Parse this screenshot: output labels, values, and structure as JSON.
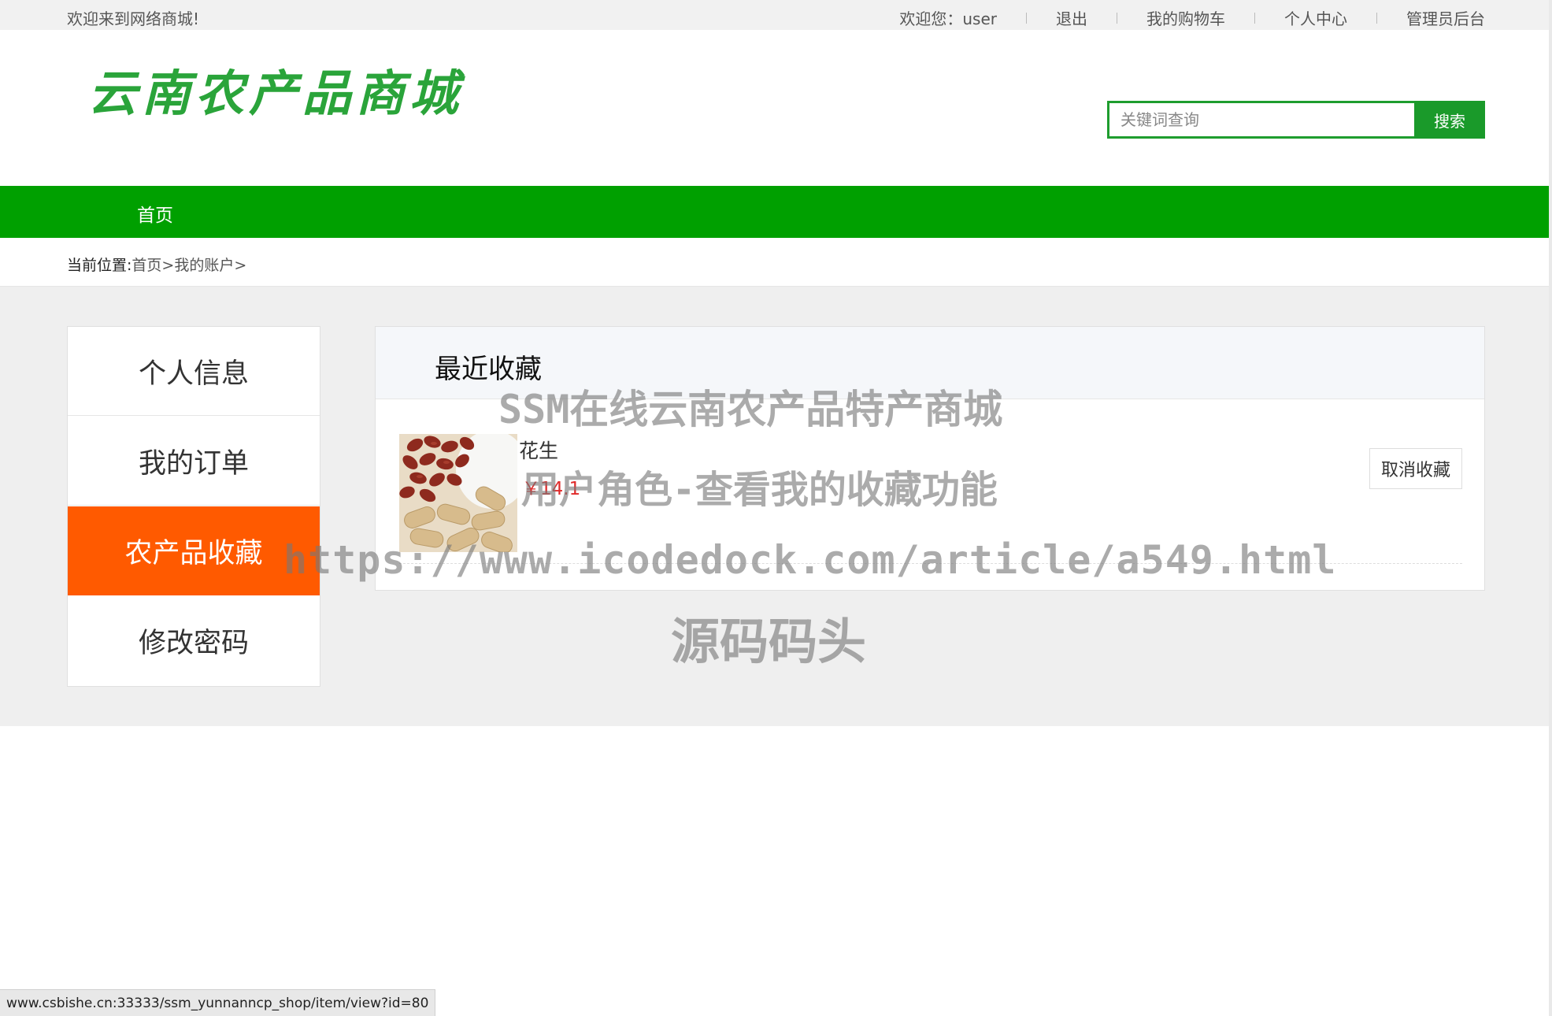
{
  "topbar": {
    "welcome": "欢迎来到网络商城!",
    "greeting": "欢迎您：user",
    "logout": "退出",
    "cart": "我的购物车",
    "profile": "个人中心",
    "admin": "管理员后台"
  },
  "header": {
    "logo": "云南农产品商城",
    "search_placeholder": "关键词查询",
    "search_button": "搜索"
  },
  "nav": {
    "home": "首页"
  },
  "breadcrumb": {
    "label": "当前位置:",
    "home": "首页",
    "sep1": ">",
    "account": "我的账户",
    "sep2": ">"
  },
  "sidebar": {
    "items": [
      {
        "label": "个人信息"
      },
      {
        "label": "我的订单"
      },
      {
        "label": "农产品收藏"
      },
      {
        "label": "修改密码"
      }
    ]
  },
  "favorites": {
    "title": "最近收藏",
    "items": [
      {
        "name": "花生",
        "price": "￥14.1",
        "action": "取消收藏"
      }
    ]
  },
  "status_bar": "www.csbishe.cn:33333/ssm_yunnanncp_shop/item/view?id=80",
  "watermark": {
    "line1": "SSM在线云南农产品特产商城",
    "line2": "用户角色-查看我的收藏功能",
    "line3": "https://www.icodedock.com/article/a549.html",
    "line4": "源码码头"
  },
  "colors": {
    "brand_green": "#00a000",
    "active_orange": "#ff5a00",
    "price_red": "#e02a2a"
  }
}
